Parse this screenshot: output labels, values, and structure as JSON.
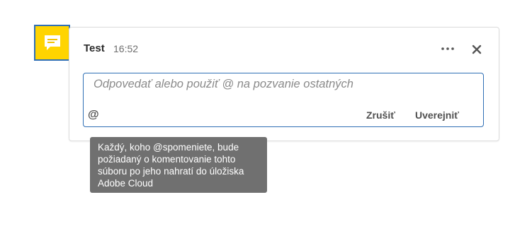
{
  "comment": {
    "icon": "speech-bubble-icon",
    "icon_bg": "#ffd400",
    "icon_border": "#2f6fb5",
    "author": "Test",
    "time": "16:52",
    "more_icon": "more-options-icon",
    "close_icon": "close-icon"
  },
  "reply": {
    "placeholder": "Odpovedať alebo použiť @ na pozvanie ostatných",
    "value": "",
    "mention_label": "@",
    "cancel_label": "Zrušiť",
    "post_label": "Uverejniť",
    "border_color": "#2f6fb5"
  },
  "tooltip": {
    "text": "Každý, koho @spomeniete, bude požiadaný o komentovanie tohto súboru po jeho nahratí do úložiska Adobe Cloud"
  }
}
